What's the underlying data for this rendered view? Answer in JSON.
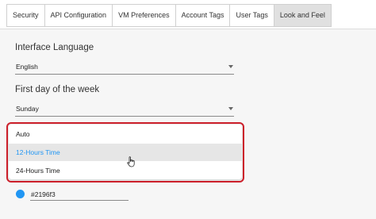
{
  "tabs": [
    {
      "label": "Security",
      "active": false
    },
    {
      "label": "API Configuration",
      "active": false
    },
    {
      "label": "VM Preferences",
      "active": false
    },
    {
      "label": "Account Tags",
      "active": false
    },
    {
      "label": "User Tags",
      "active": false
    },
    {
      "label": "Look and Feel",
      "active": true
    }
  ],
  "interface_language": {
    "label": "Interface Language",
    "value": "English"
  },
  "first_day": {
    "label": "First day of the week",
    "value": "Sunday"
  },
  "time_format_dropdown": {
    "options": [
      "Auto",
      "12-Hours Time",
      "24-Hours Time"
    ],
    "hovered": "12-Hours Time"
  },
  "theme_color": {
    "value": "#2196f3",
    "swatch": "#2196f3"
  },
  "colors": {
    "accent": "#2196f3",
    "highlight_border": "#cc1f2a"
  }
}
